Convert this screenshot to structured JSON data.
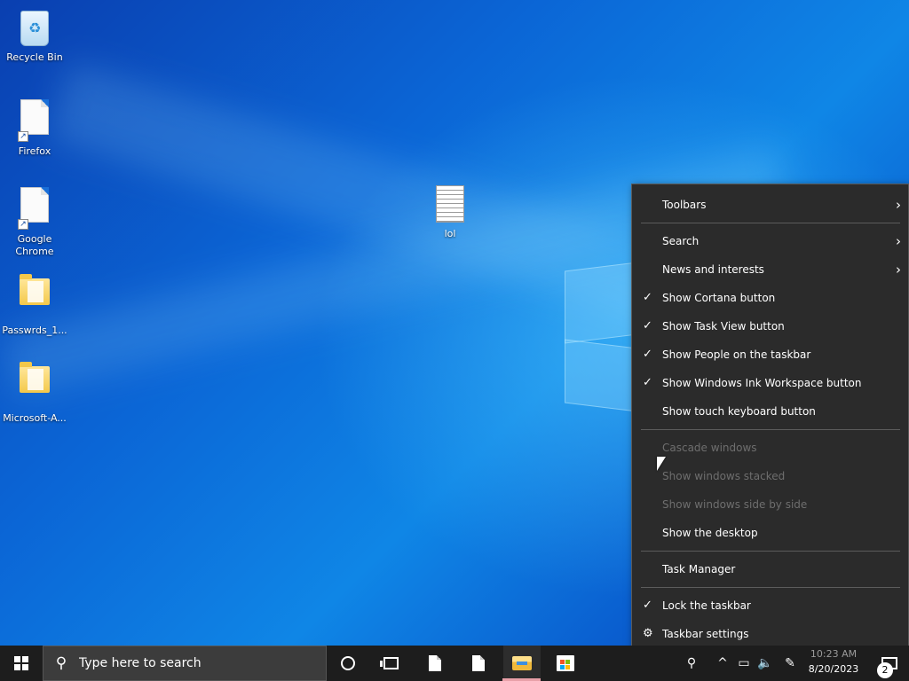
{
  "desktop": {
    "icons": [
      {
        "label": "Recycle Bin",
        "type": "recycle-bin"
      },
      {
        "label": "Firefox",
        "type": "shortcut-file"
      },
      {
        "label": "Google Chrome",
        "type": "shortcut-file"
      },
      {
        "label": "Passwrds_1...",
        "type": "folder"
      },
      {
        "label": "Microsoft-A...",
        "type": "folder"
      },
      {
        "label": "lol",
        "type": "text-file"
      }
    ]
  },
  "context_menu": {
    "items": [
      {
        "label": "Toolbars",
        "checked": false,
        "submenu": true,
        "disabled": false
      },
      {
        "label": "Search",
        "checked": false,
        "submenu": true,
        "disabled": false
      },
      {
        "label": "News and interests",
        "checked": false,
        "submenu": true,
        "disabled": false
      },
      {
        "label": "Show Cortana button",
        "checked": true,
        "submenu": false,
        "disabled": false
      },
      {
        "label": "Show Task View button",
        "checked": true,
        "submenu": false,
        "disabled": false
      },
      {
        "label": "Show People on the taskbar",
        "checked": true,
        "submenu": false,
        "disabled": false
      },
      {
        "label": "Show Windows Ink Workspace button",
        "checked": true,
        "submenu": false,
        "disabled": false
      },
      {
        "label": "Show touch keyboard button",
        "checked": false,
        "submenu": false,
        "disabled": false
      },
      {
        "label": "Cascade windows",
        "checked": false,
        "submenu": false,
        "disabled": true
      },
      {
        "label": "Show windows stacked",
        "checked": false,
        "submenu": false,
        "disabled": true
      },
      {
        "label": "Show windows side by side",
        "checked": false,
        "submenu": false,
        "disabled": true
      },
      {
        "label": "Show the desktop",
        "checked": false,
        "submenu": false,
        "disabled": false
      },
      {
        "label": "Task Manager",
        "checked": false,
        "submenu": false,
        "disabled": false
      },
      {
        "label": "Lock the taskbar",
        "checked": true,
        "submenu": false,
        "disabled": false
      },
      {
        "label": "Taskbar settings",
        "checked": false,
        "submenu": false,
        "disabled": false,
        "icon": "gear-icon"
      }
    ],
    "check_glyph": "✓",
    "arrow_glyph": "›",
    "gear_glyph": "⚙"
  },
  "taskbar": {
    "search_placeholder": "Type here to search",
    "tray": {
      "people_glyph": "⚲",
      "chevron_glyph": "^",
      "network_glyph": "▭",
      "volume_glyph": "🔈",
      "ink_glyph": "✎"
    },
    "clock": {
      "time": "10:23 AM",
      "date": "8/20/2023"
    },
    "notification_count": "2"
  },
  "colors": {
    "menu_bg": "#2b2b2b",
    "taskbar_bg": "#1d1d1d",
    "disabled_text": "#6e6e6e"
  }
}
